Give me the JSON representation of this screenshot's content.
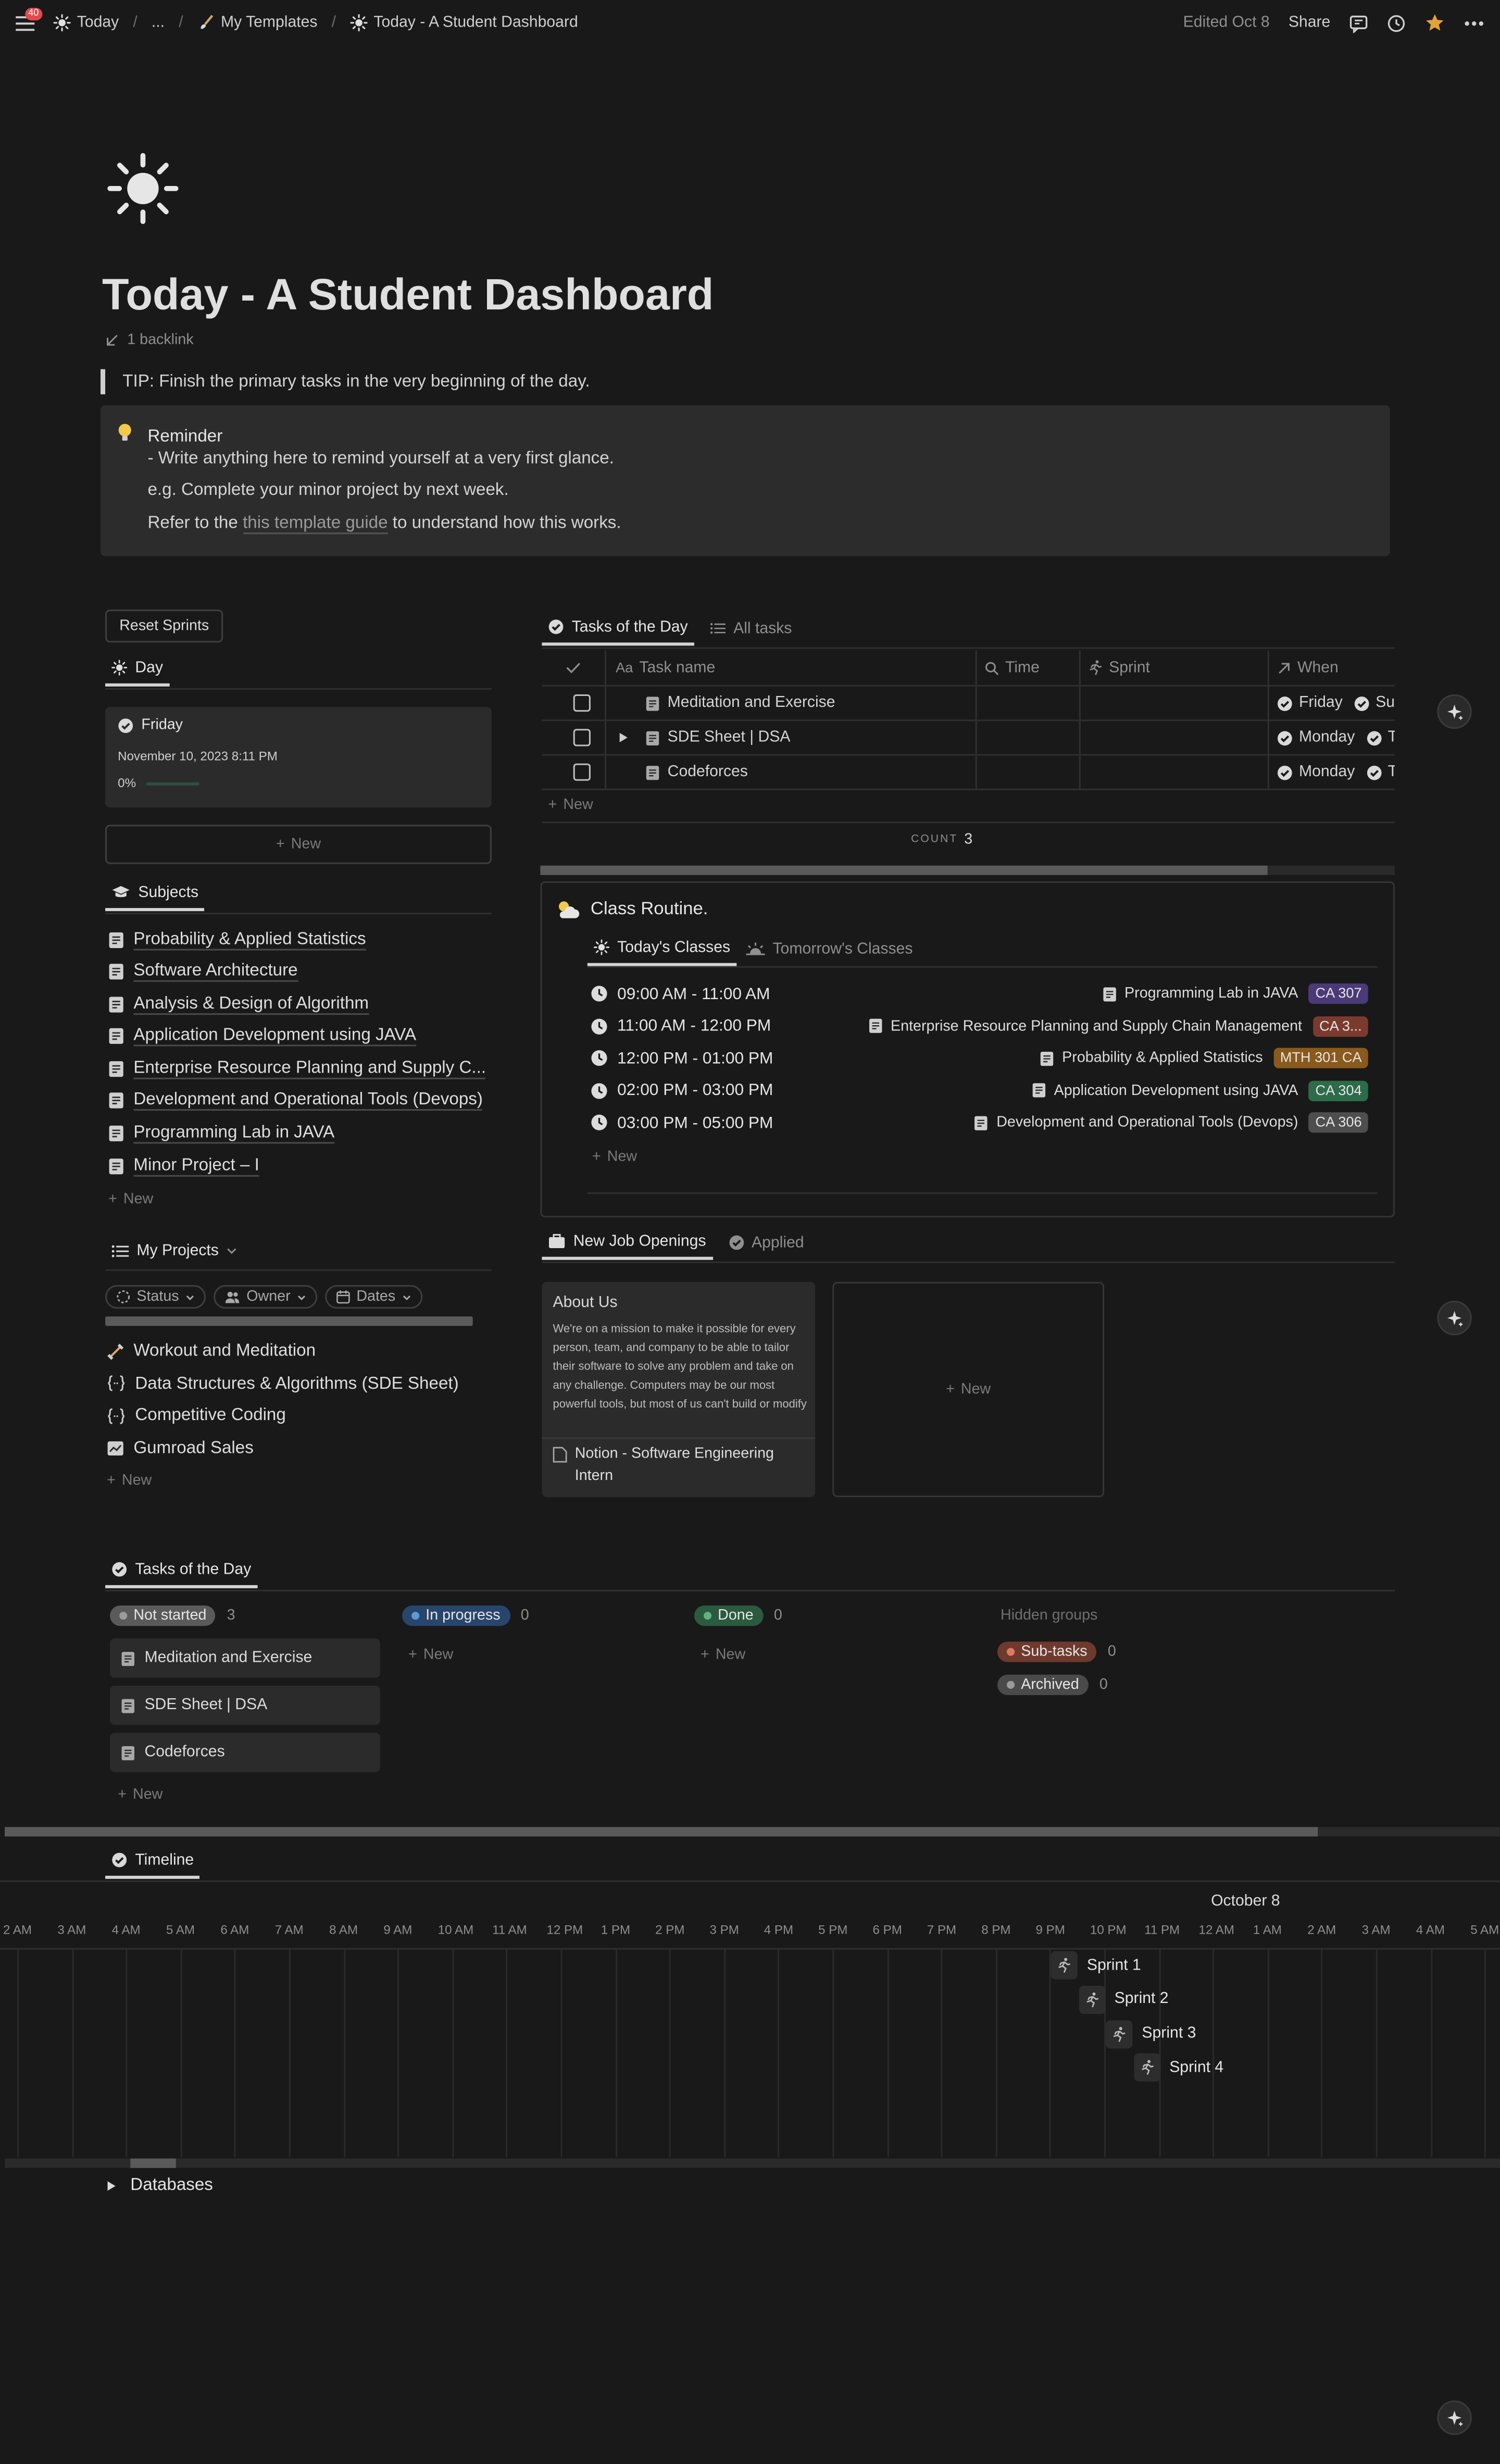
{
  "topbar": {
    "notif_count": "40",
    "crumb_today": "Today",
    "crumb_ellipsis": "...",
    "crumb_templates": "My Templates",
    "crumb_page": "Today - A Student Dashboard",
    "edited": "Edited Oct 8",
    "share": "Share"
  },
  "page": {
    "title": "Today - A Student Dashboard",
    "backlink": "1 backlink",
    "tip": "TIP: Finish the primary tasks in the very beginning of the day.",
    "reminder_title": "Reminder",
    "reminder_line1": "- Write anything here to remind yourself at a very first glance.",
    "reminder_line2": "e.g. Complete your minor project by next week.",
    "reminder_pre": "Refer to the ",
    "reminder_link": "this template guide",
    "reminder_post": " to understand how this works."
  },
  "day_panel": {
    "reset_button": "Reset Sprints",
    "tab": "Day",
    "card_title": "Friday",
    "card_date": "November 10, 2023 8:11 PM",
    "card_progress_label": "0%",
    "card_progress": 0,
    "new_label": "New"
  },
  "subjects": {
    "tab": "Subjects",
    "items": [
      "Probability & Applied Statistics",
      "Software Architecture",
      "Analysis & Design of Algorithm",
      "Application Development using JAVA",
      "Enterprise Resource Planning and Supply C...",
      "Development and Operational Tools (Devops)",
      "Programming Lab in JAVA",
      "Minor Project – I"
    ],
    "new_label": "New"
  },
  "projects": {
    "tab": "My Projects",
    "filters": [
      "Status",
      "Owner",
      "Dates"
    ],
    "items": [
      {
        "label": "Workout and Meditation",
        "icon": "dumbbell-icon"
      },
      {
        "label": "Data Structures & Algorithms (SDE Sheet)",
        "icon": "code-braces-icon"
      },
      {
        "label": "Competitive Coding",
        "icon": "code-braces-icon"
      },
      {
        "label": "Gumroad Sales",
        "icon": "chart-icon"
      }
    ],
    "new_label": "New"
  },
  "tasks_table": {
    "tab_active": "Tasks of the Day",
    "tab_other": "All tasks",
    "headers": {
      "name": "Task name",
      "time": "Time",
      "sprint": "Sprint",
      "when": "When"
    },
    "rows": [
      {
        "name": "Meditation and Exercise",
        "when": "Friday",
        "when2": "Su"
      },
      {
        "name": "SDE Sheet | DSA",
        "when": "Monday",
        "when2": "T"
      },
      {
        "name": "Codeforces",
        "when": "Monday",
        "when2": "T"
      }
    ],
    "new_label": "New",
    "count_label": "COUNT",
    "count_value": "3"
  },
  "class_routine": {
    "title": "Class Routine.",
    "tab_today": "Today's Classes",
    "tab_tomorrow": "Tomorrow's Classes",
    "rows": [
      {
        "time": "09:00 AM - 11:00 AM",
        "subject": "Programming Lab in JAVA",
        "room": "CA 307",
        "color": "#4b3a78"
      },
      {
        "time": "11:00 AM - 12:00 PM",
        "subject": "Enterprise Resource Planning and Supply Chain Management",
        "room": "CA 3...",
        "color": "#7a3b2e"
      },
      {
        "time": "12:00 PM - 01:00 PM",
        "subject": "Probability & Applied Statistics",
        "room": "MTH 301 CA",
        "color": "#8a5a1c"
      },
      {
        "time": "02:00 PM - 03:00 PM",
        "subject": "Application Development using JAVA",
        "room": "CA 304",
        "color": "#2e6b4a"
      },
      {
        "time": "03:00 PM - 05:00 PM",
        "subject": "Development and Operational Tools (Devops)",
        "room": "CA 306",
        "color": "#4e4e4e"
      }
    ],
    "new_label": "New"
  },
  "jobs": {
    "tab_active": "New Job Openings",
    "tab_other": "Applied",
    "card_heading": "About Us",
    "card_body": "We're on a mission to make it possible for every person, team, and company to be able to tailor their software to solve any problem and take on any challenge. Computers may be our most powerful tools, but most of us can't build or modify",
    "card_title": "Notion - Software Engineering Intern",
    "new_label": "New"
  },
  "board": {
    "tab": "Tasks of the Day",
    "groups": [
      {
        "label": "Not started",
        "count": "3",
        "color": "#5a5a5a",
        "dot": "#9b9b9b"
      },
      {
        "label": "In progress",
        "count": "0",
        "color": "#28456c",
        "dot": "#5b9bd5"
      },
      {
        "label": "Done",
        "count": "0",
        "color": "#2b5a3f",
        "dot": "#5fb37f"
      }
    ],
    "cards": [
      "Meditation and Exercise",
      "SDE Sheet | DSA",
      "Codeforces"
    ],
    "hidden_label": "Hidden groups",
    "hidden": [
      {
        "label": "Sub-tasks",
        "count": "0",
        "color": "#6e3a2e",
        "dot": "#e07a5f"
      },
      {
        "label": "Archived",
        "count": "0",
        "color": "#4a4a4a",
        "dot": "#9b9b9b"
      }
    ],
    "new_label": "New"
  },
  "timeline": {
    "tab": "Timeline",
    "date_label": "October 8",
    "ticks": [
      "2 AM",
      "3 AM",
      "4 AM",
      "5 AM",
      "6 AM",
      "7 AM",
      "8 AM",
      "9 AM",
      "10 AM",
      "11 AM",
      "12 PM",
      "1 PM",
      "2 PM",
      "3 PM",
      "4 PM",
      "5 PM",
      "6 PM",
      "7 PM",
      "8 PM",
      "9 PM",
      "10 PM",
      "11 PM",
      "12 AM",
      "1 AM",
      "2 AM",
      "3 AM",
      "4 AM",
      "5 AM"
    ],
    "sprints": [
      "Sprint 1",
      "Sprint 2",
      "Sprint 3",
      "Sprint 4"
    ]
  },
  "databases": {
    "label": "Databases"
  }
}
